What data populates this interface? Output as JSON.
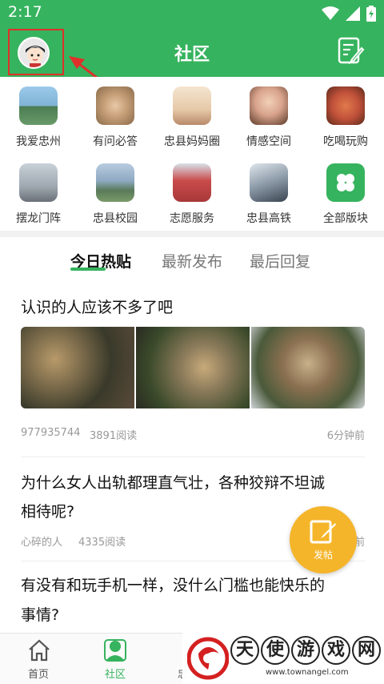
{
  "status": {
    "time": "2:17"
  },
  "header": {
    "title": "社区"
  },
  "categories": [
    {
      "label": "我爱忠州",
      "color": "#7fb3d5"
    },
    {
      "label": "有问必答",
      "color": "#c8a17a"
    },
    {
      "label": "忠县妈妈圈",
      "color": "#e6c9a8"
    },
    {
      "label": "情感空间",
      "color": "#d9a38c"
    },
    {
      "label": "吃喝玩购",
      "color": "#c0503a"
    },
    {
      "label": "摆龙门阵",
      "color": "#9fa8b0"
    },
    {
      "label": "忠县校园",
      "color": "#8fa9c2"
    },
    {
      "label": "志愿服务",
      "color": "#c94b4b"
    },
    {
      "label": "忠县高铁",
      "color": "#8c9aa8"
    },
    {
      "label": "全部版块",
      "color": "#36b35e"
    }
  ],
  "tabs": [
    {
      "label": "今日热贴"
    },
    {
      "label": "最新发布"
    },
    {
      "label": "最后回复"
    }
  ],
  "posts": [
    {
      "title": "认识的人应该不多了吧",
      "author": "977935744",
      "reads": "3891阅读",
      "time": "6分钟前"
    },
    {
      "title_line1": "为什么女人出轨都理直气壮，各种狡辩不坦诚",
      "title_line2": "相待呢?",
      "author": "心碎的人",
      "reads": "4335阅读",
      "time": "前"
    },
    {
      "title_line1": "有没有和玩手机一样，没什么门槛也能快乐的",
      "title_line2": "事情?"
    }
  ],
  "fab": {
    "label": "发帖"
  },
  "nav": [
    {
      "label": "首页"
    },
    {
      "label": "社区"
    },
    {
      "label": "忠"
    }
  ],
  "watermark": {
    "chars": [
      "天",
      "使",
      "游",
      "戏",
      "网"
    ],
    "url": "www.townangel.com"
  },
  "colors": {
    "brand": "#36b35e",
    "fab": "#f5b52a",
    "highlight": "#e0302a"
  }
}
